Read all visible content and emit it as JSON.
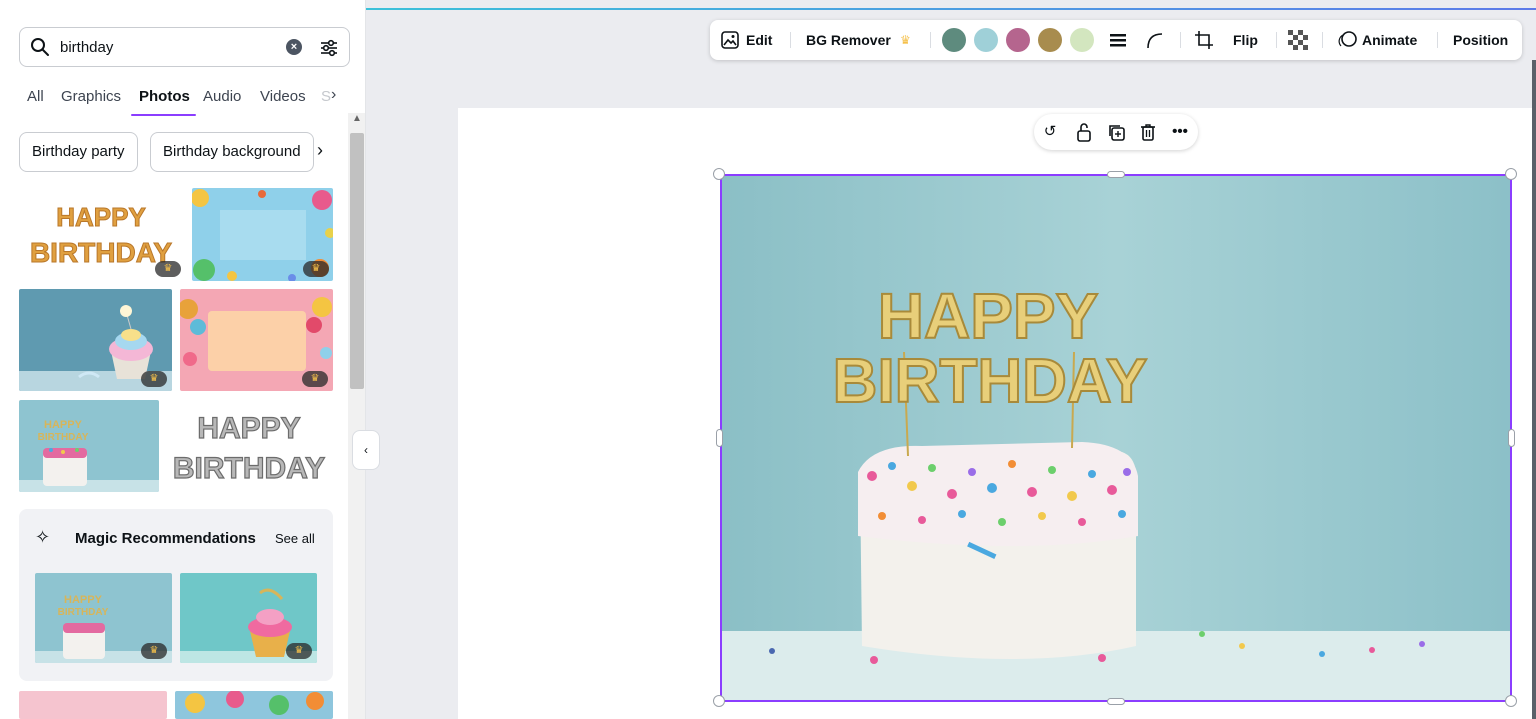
{
  "search": {
    "value": "birthday",
    "clear_glyph": "×"
  },
  "tabs": [
    {
      "label": "All"
    },
    {
      "label": "Graphics"
    },
    {
      "label": "Photos"
    },
    {
      "label": "Audio"
    },
    {
      "label": "Videos"
    },
    {
      "label": "S"
    }
  ],
  "tabs_next_glyph": "›",
  "chips": [
    {
      "label": "Birthday party"
    },
    {
      "label": "Birthday background"
    }
  ],
  "chips_next_glyph": "›",
  "results": {
    "balloon_text_1": "HAPPY",
    "balloon_text_2": "BIRTHDAY",
    "crown_glyph": "♛"
  },
  "magic": {
    "title": "Magic Recommendations",
    "see_all": "See all"
  },
  "collapse_glyph": "‹",
  "toolbar": {
    "edit": "Edit",
    "bg_remover": "BG Remover",
    "flip": "Flip",
    "animate": "Animate",
    "position": "Position"
  },
  "swatches": [
    "#5e8b7e",
    "#9fd0d8",
    "#b5658e",
    "#a88c4e",
    "#d3e6bf"
  ],
  "photo": {
    "topper_line_1": "HAPPY",
    "topper_line_2": "BIRTHDAY"
  }
}
